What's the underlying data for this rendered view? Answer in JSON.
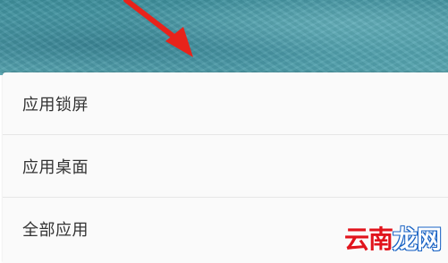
{
  "menu": {
    "items": [
      {
        "label": "应用锁屏"
      },
      {
        "label": "应用桌面"
      },
      {
        "label": "全部应用"
      }
    ]
  },
  "watermark": {
    "part1": "云南",
    "part2": "龙网"
  },
  "colors": {
    "wallpaper": "#4e9eaa",
    "arrow": "#e8231b",
    "sheet_background": "#fafafa",
    "divider": "#e6e6e6",
    "menu_text": "#333333"
  },
  "icons": [
    "red-arrow-icon"
  ]
}
